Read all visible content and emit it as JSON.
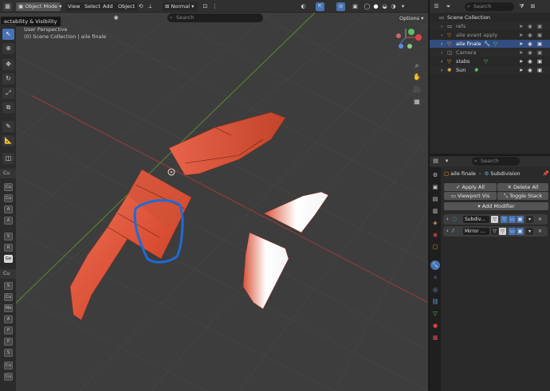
{
  "header": {
    "mode": "Object Mode",
    "menus": [
      "View",
      "Select",
      "Add",
      "Object"
    ],
    "orientation": "Normal",
    "search_placeholder": "Search",
    "options": "Options"
  },
  "tooltip": "ectability & Visibility",
  "viewport_info": {
    "line1": "User Perspective",
    "line2": "(0) Scene Collection | aile finale"
  },
  "outliner": {
    "search_placeholder": "Search",
    "root": "Scene Collection",
    "rows": [
      {
        "name": "refs",
        "selected": false,
        "dim": true
      },
      {
        "name": "aile avant apply",
        "selected": false,
        "dim": true
      },
      {
        "name": "aile finale",
        "selected": true,
        "dim": false
      },
      {
        "name": "Camera",
        "selected": false,
        "dim": true
      },
      {
        "name": "stabs",
        "selected": false,
        "dim": false
      },
      {
        "name": "Sun",
        "selected": false,
        "dim": false
      }
    ]
  },
  "properties": {
    "search_placeholder": "Search",
    "breadcrumb_object": "aile finale",
    "breadcrumb_modifier": "Subdivision",
    "apply_all": "Apply All",
    "delete_all": "Delete All",
    "viewport_vis": "Viewport Vis",
    "toggle_stack": "Toggle Stack",
    "add_modifier": "Add Modifier",
    "modifiers": [
      {
        "name": "Subdiv..."
      },
      {
        "name": "Mirror ..."
      }
    ]
  },
  "side_panel": {
    "cat1": "Cu",
    "cat2": "Cu",
    "items1": [
      "Cu",
      "Cu",
      "A",
      "A",
      "S",
      "R",
      "Ge"
    ],
    "items2": [
      "S",
      "Cu",
      "Mo",
      "A",
      "P",
      "P",
      "S",
      "Cu",
      "Cu"
    ]
  },
  "colors": {
    "accent": "#4772b3",
    "wing": "#e05a3c",
    "annotation": "#1e6bd6"
  }
}
